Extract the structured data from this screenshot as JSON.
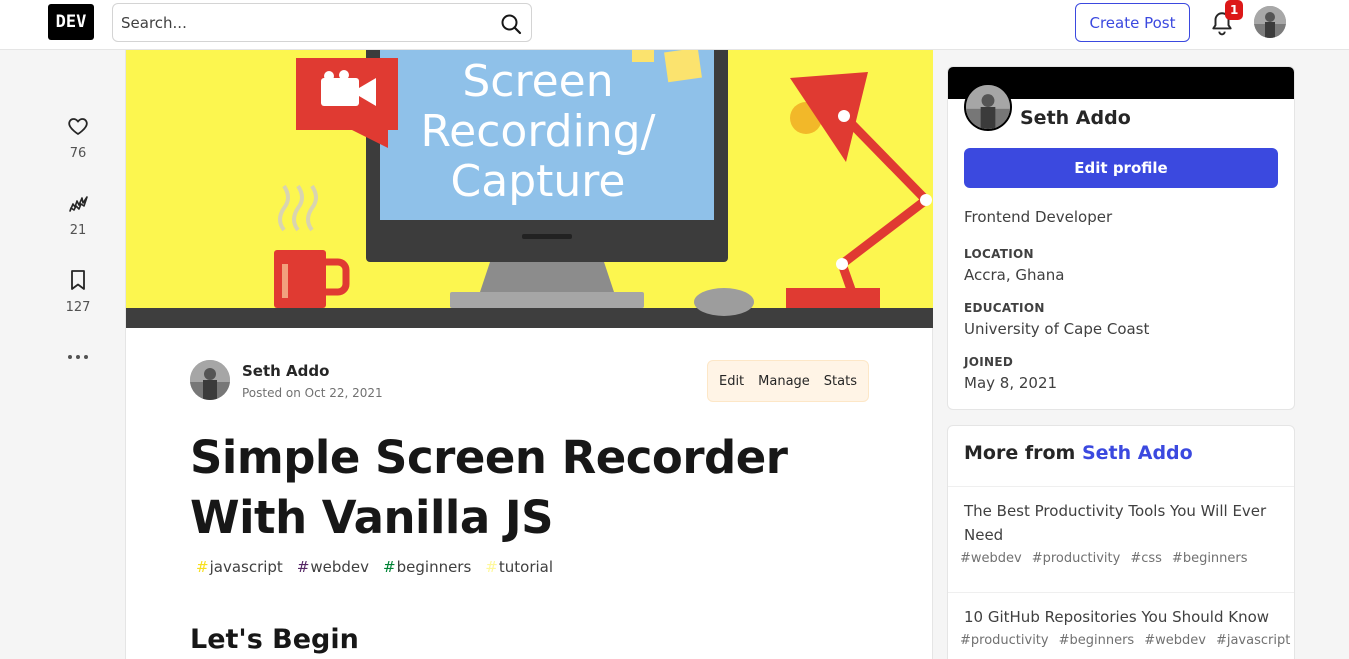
{
  "header": {
    "logo": "DEV",
    "search_placeholder": "Search...",
    "create_post_label": "Create Post",
    "notification_count": "1"
  },
  "reactions": {
    "likes": "76",
    "unicorns": "21",
    "bookmarks": "127"
  },
  "article": {
    "cover_text_lines": [
      "Screen",
      "Recording/",
      "Capture"
    ],
    "author": "Seth Addo",
    "posted": "Posted on Oct 22, 2021",
    "actions": {
      "edit": "Edit",
      "manage": "Manage",
      "stats": "Stats"
    },
    "title": "Simple Screen Recorder With Vanilla JS",
    "tags": [
      {
        "name": "javascript",
        "color": "#f7df1e"
      },
      {
        "name": "webdev",
        "color": "#562765"
      },
      {
        "name": "beginners",
        "color": "#008335"
      },
      {
        "name": "tutorial",
        "color": "#fef89a"
      }
    ],
    "first_heading": "Let's Begin"
  },
  "profile": {
    "name": "Seth Addo",
    "edit_profile_label": "Edit profile",
    "bio": "Frontend Developer",
    "location_label": "LOCATION",
    "location": "Accra, Ghana",
    "education_label": "EDUCATION",
    "education": "University of Cape Coast",
    "joined_label": "JOINED",
    "joined": "May 8, 2021"
  },
  "more_from": {
    "prefix": "More from",
    "author": "Seth Addo",
    "items": [
      {
        "title": "The Best Productivity Tools You Will Ever Need",
        "tags": [
          "#webdev",
          "#productivity",
          "#css",
          "#beginners"
        ]
      },
      {
        "title": "10 GitHub Repositories You Should Know",
        "tags": [
          "#productivity",
          "#beginners",
          "#webdev",
          "#javascript"
        ]
      }
    ]
  },
  "colors": {
    "accent": "#3b49df",
    "badge": "#dc1818",
    "cover_bg": "#fcf64f"
  }
}
